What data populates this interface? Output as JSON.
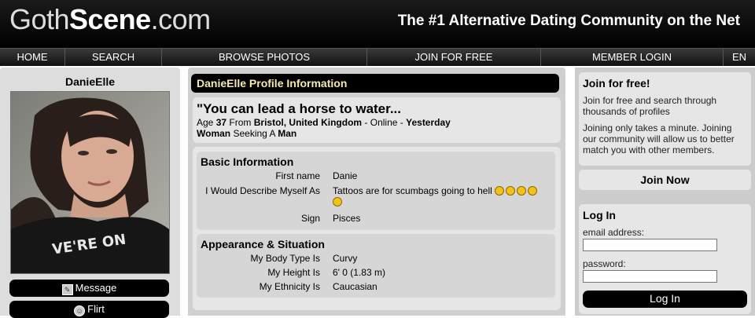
{
  "header": {
    "logo_left": "Goth",
    "logo_bold": "Scene",
    "logo_right": ".com",
    "tagline": "The #1 Alternative Dating Community on the Net"
  },
  "nav": {
    "home": "HOME",
    "search": "SEARCH",
    "browse": "BROWSE PHOTOS",
    "join": "JOIN FOR FREE",
    "login": "MEMBER LOGIN",
    "lang": "EN"
  },
  "left": {
    "username": "DanieElle",
    "message": "Message",
    "flirt": "Flirt",
    "photo_shirt_text": "VE'RE ON"
  },
  "profile": {
    "title": "DanieElle Profile Information",
    "headline": "\"You can lead a horse to water...",
    "age_label": "Age",
    "age": "37",
    "from_label": "From",
    "location": "Bristol, United Kingdom",
    "online_text": "- Online -",
    "last_seen": "Yesterday",
    "gender": "Woman",
    "seeking_label": "Seeking A",
    "seeking": "Man"
  },
  "basic": {
    "heading": "Basic Information",
    "first_name_label": "First name",
    "first_name": "Danie",
    "describe_label": "I Would Describe Myself As",
    "describe": "Tattoos are for scumbags going to hell",
    "sign_label": "Sign",
    "sign": "Pisces"
  },
  "appearance": {
    "heading": "Appearance & Situation",
    "body_label": "My Body Type Is",
    "body": "Curvy",
    "height_label": "My Height Is",
    "height": "6' 0 (1.83 m)",
    "ethnicity_label": "My Ethnicity Is",
    "ethnicity": "Caucasian"
  },
  "join_box": {
    "heading": "Join for free!",
    "p1": "Join for free and search through thousands of profiles",
    "p2": "Joining only takes a minute. Joining our community will allow us to better match you with other members.",
    "button": "Join Now"
  },
  "login_box": {
    "heading": "Log In",
    "email_label": "email address:",
    "password_label": "password:",
    "button": "Log In"
  },
  "colors": {
    "title_text": "#f6e8b1",
    "emoji": "#f2c21b"
  }
}
